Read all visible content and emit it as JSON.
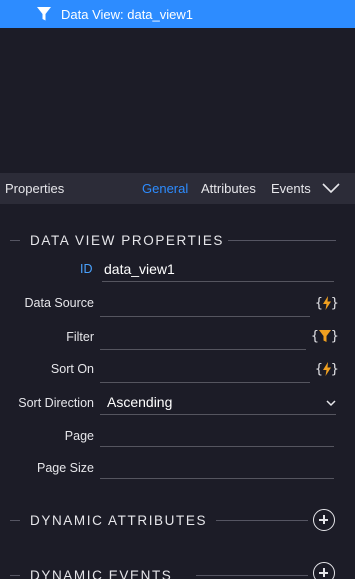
{
  "outline": {
    "selected_item": "Data View: data_view1"
  },
  "properties_panel": {
    "title": "Properties",
    "tabs": [
      {
        "label": "General",
        "active": true
      },
      {
        "label": "Attributes",
        "active": false
      },
      {
        "label": "Events",
        "active": false
      }
    ]
  },
  "data_view_section": {
    "title": "DATA VIEW PROPERTIES",
    "id_badge": "ID",
    "id_value": "data_view1",
    "fields": {
      "data_source": {
        "label": "Data Source",
        "value": ""
      },
      "filter": {
        "label": "Filter",
        "value": ""
      },
      "sort_on": {
        "label": "Sort On",
        "value": ""
      },
      "sort_direction": {
        "label": "Sort Direction",
        "value": "Ascending"
      },
      "page": {
        "label": "Page",
        "value": ""
      },
      "page_size": {
        "label": "Page Size",
        "value": ""
      }
    }
  },
  "dynamic_attributes": {
    "title": "DYNAMIC ATTRIBUTES"
  },
  "dynamic_events": {
    "title": "DYNAMIC EVENTS"
  },
  "colors": {
    "accent": "#2d8cff",
    "panel_bg": "#1c1c27",
    "bar_bg": "#2c2c38",
    "bolt": "#f0a020"
  },
  "icons": {
    "tree_item": "funnel-icon",
    "binding": "lightning-bolt-icon",
    "filter_binding": "funnel-icon",
    "collapse": "chevron-down-icon",
    "add": "plus-circle-icon"
  }
}
